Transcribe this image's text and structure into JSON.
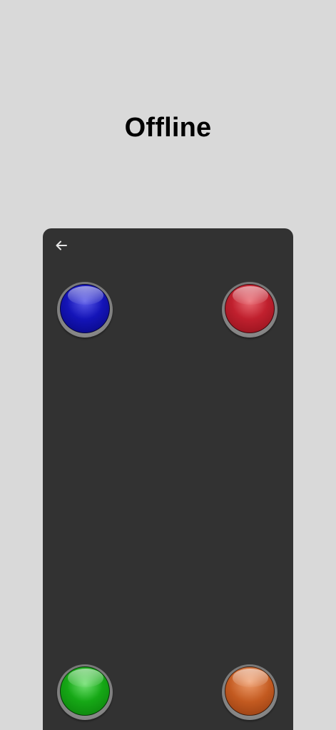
{
  "screen": {
    "title": "Offline"
  },
  "panel": {
    "back_icon": "arrow-left-icon",
    "buttons": [
      {
        "name": "blue-button",
        "color": "#1414b8"
      },
      {
        "name": "red-button",
        "color": "#c0202e"
      },
      {
        "name": "green-button",
        "color": "#16a816"
      },
      {
        "name": "orange-button",
        "color": "#c35a20"
      }
    ]
  },
  "colors": {
    "background": "#d9d9d9",
    "panel": "#323232"
  }
}
